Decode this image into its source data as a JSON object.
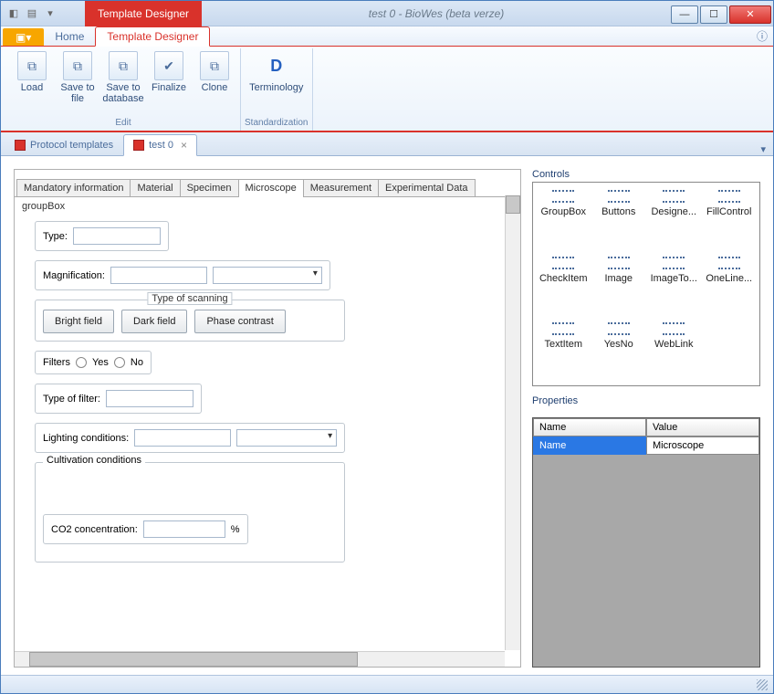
{
  "window": {
    "title": "test 0 - BioWes (beta verze)",
    "title_tab": "Template Designer"
  },
  "menu": {
    "file_glyph": "▣▾",
    "home": "Home",
    "designer": "Template Designer"
  },
  "ribbon": {
    "edit_group": "Edit",
    "std_group": "Standardization",
    "load": "Load",
    "save_file": "Save to file",
    "save_db": "Save to database",
    "finalize": "Finalize",
    "clone": "Clone",
    "terminology": "Terminology"
  },
  "doc_tabs": {
    "protocols": "Protocol templates",
    "test0": "test 0",
    "close": "×"
  },
  "form": {
    "tabs": [
      "Mandatory information",
      "Material",
      "Specimen",
      "Microscope",
      "Measurement",
      "Experimental Data"
    ],
    "groupbox": "groupBox",
    "type": "Type:",
    "magnification": "Magnification:",
    "scan_legend": "Type of scanning",
    "bright": "Bright field",
    "dark": "Dark field",
    "phase": "Phase contrast",
    "filters": "Filters",
    "yes": "Yes",
    "no": "No",
    "filter_type": "Type of filter:",
    "lighting": "Lighting conditions:",
    "cultivation": "Cultivation conditions",
    "co2": "CO2 concentration:",
    "co2_unit": "%"
  },
  "controls": {
    "label": "Controls",
    "items": [
      "GroupBox",
      "Buttons",
      "Designe...",
      "FillControl",
      "CheckItem",
      "Image",
      "ImageTo...",
      "OneLine...",
      "TextItem",
      "YesNo",
      "WebLink"
    ]
  },
  "props": {
    "label": "Properties",
    "head_name": "Name",
    "head_value": "Value",
    "row_name": "Name",
    "row_value": "Microscope"
  }
}
